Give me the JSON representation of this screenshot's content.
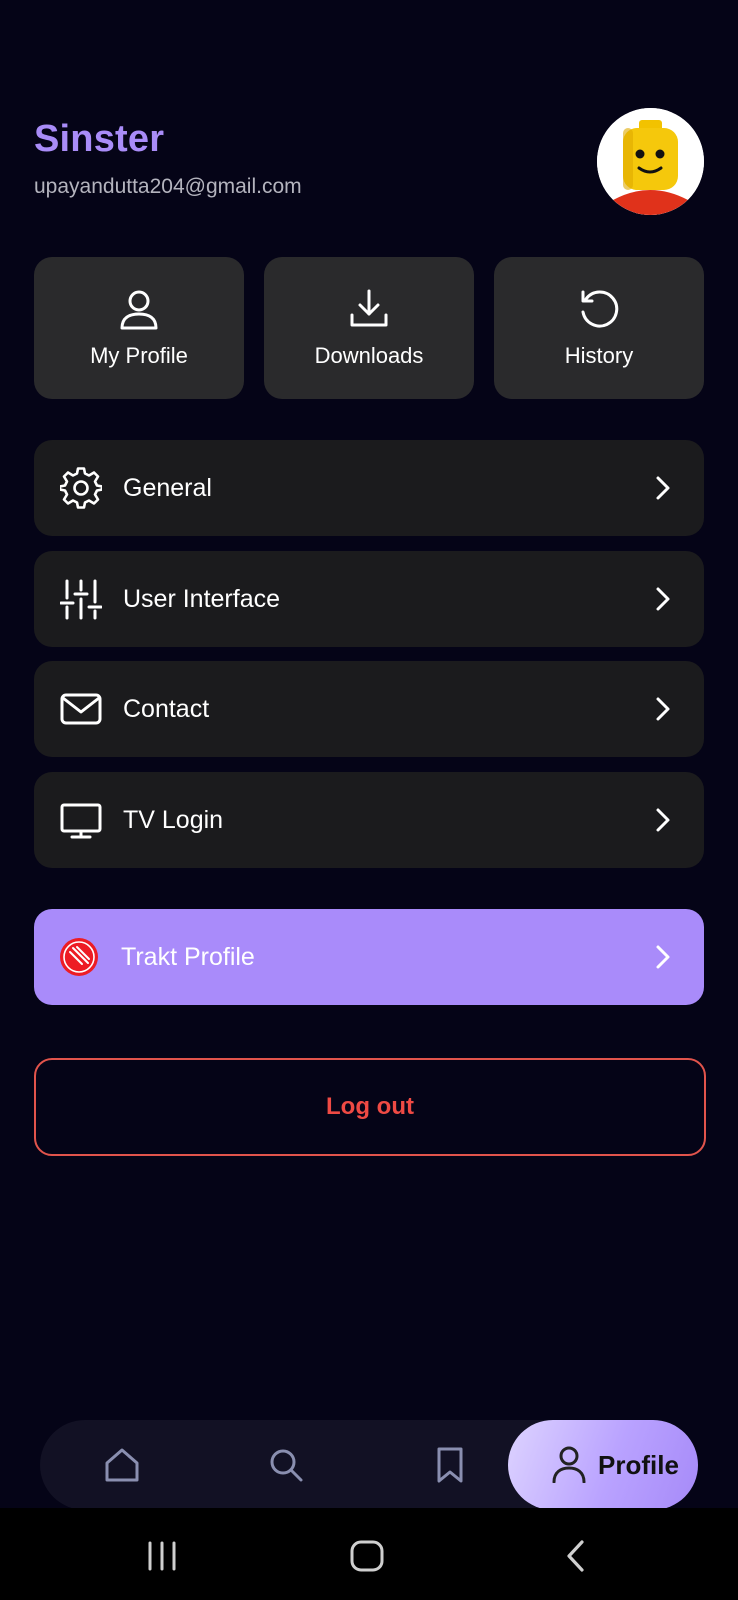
{
  "user": {
    "name": "Sinster",
    "email": "upayandutta204@gmail.com"
  },
  "tiles": [
    {
      "label": "My Profile",
      "icon": "person-icon"
    },
    {
      "label": "Downloads",
      "icon": "download-icon"
    },
    {
      "label": "History",
      "icon": "history-icon"
    }
  ],
  "menu": [
    {
      "label": "General",
      "icon": "gear-icon"
    },
    {
      "label": "User Interface",
      "icon": "sliders-icon"
    },
    {
      "label": "Contact",
      "icon": "mail-icon"
    },
    {
      "label": "TV Login",
      "icon": "tv-icon"
    }
  ],
  "trakt": {
    "label": "Trakt Profile",
    "icon": "trakt-logo-icon"
  },
  "logout": {
    "label": "Log out"
  },
  "nav": {
    "items": [
      "home-icon",
      "search-icon",
      "bookmark-icon"
    ],
    "active_label": "Profile"
  },
  "colors": {
    "background": "#050417",
    "accent": "#a98cf8",
    "danger": "#ef4a44",
    "tile": "#2a2a2c",
    "row": "#1b1b1d"
  }
}
